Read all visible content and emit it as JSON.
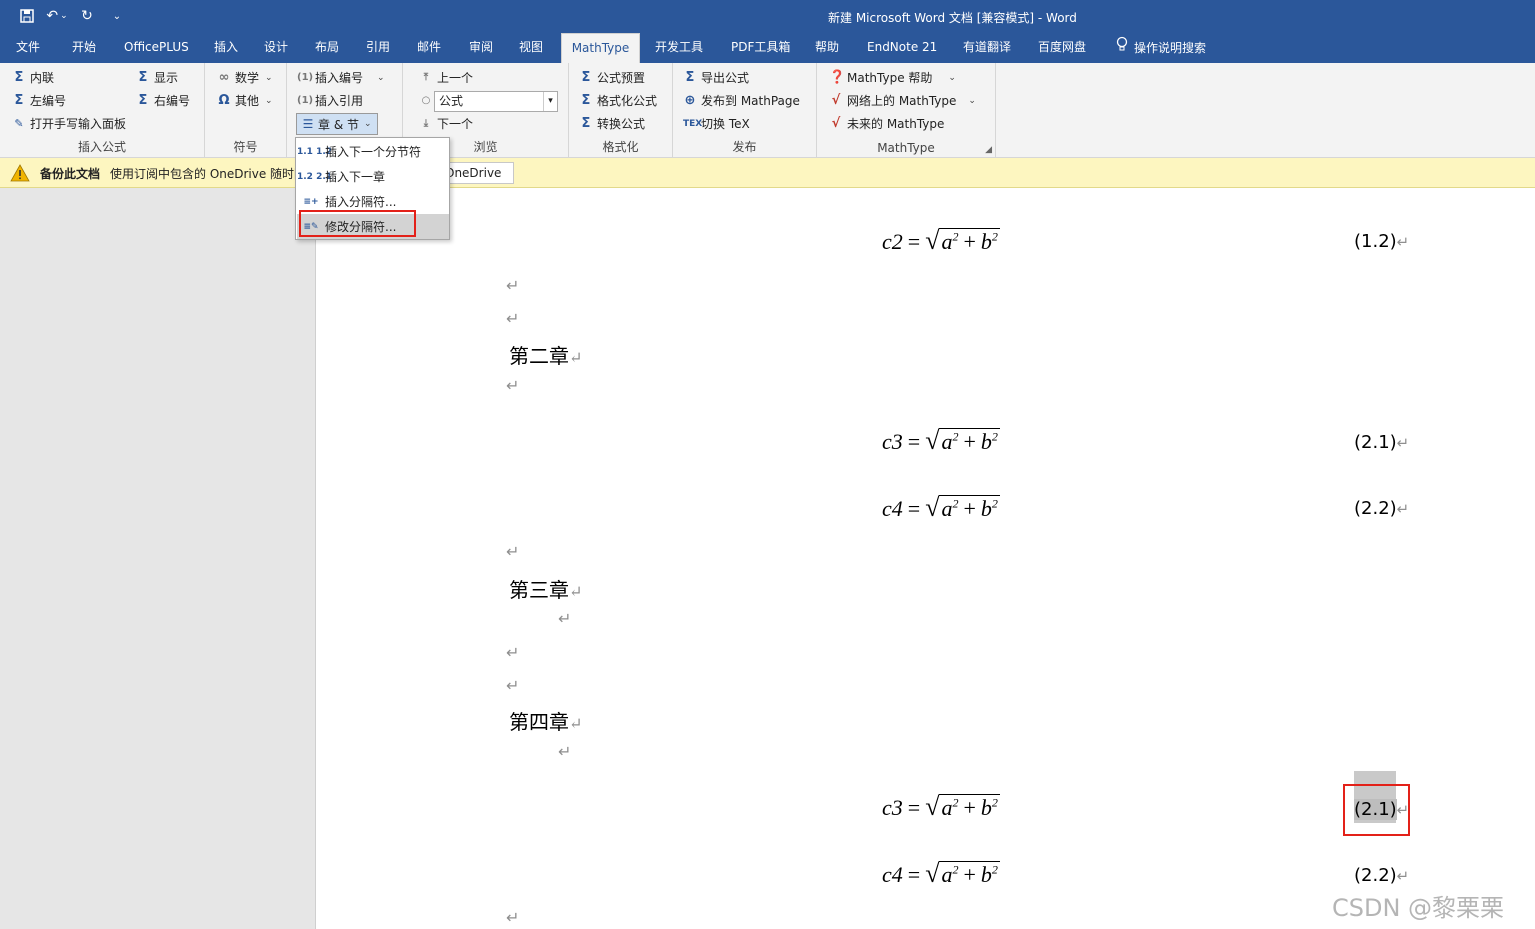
{
  "window": {
    "title": "新建 Microsoft Word 文档 [兼容模式]  -  Word"
  },
  "tabs": [
    {
      "label": "文件"
    },
    {
      "label": "开始"
    },
    {
      "label": "OfficePLUS"
    },
    {
      "label": "插入"
    },
    {
      "label": "设计"
    },
    {
      "label": "布局"
    },
    {
      "label": "引用"
    },
    {
      "label": "邮件"
    },
    {
      "label": "审阅"
    },
    {
      "label": "视图"
    },
    {
      "label": "MathType"
    },
    {
      "label": "开发工具"
    },
    {
      "label": "PDF工具箱"
    },
    {
      "label": "帮助"
    },
    {
      "label": "EndNote 21"
    },
    {
      "label": "有道翻译"
    },
    {
      "label": "百度网盘"
    },
    {
      "label": "操作说明搜索"
    }
  ],
  "ribbon": {
    "insert_equation": {
      "label": "插入公式",
      "inline": "内联",
      "display": "显示",
      "left_number": "左编号",
      "right_number": "右编号",
      "handwriting": "打开手写输入面板"
    },
    "symbols": {
      "label": "符号",
      "math": "数学",
      "other": "其他"
    },
    "numbering": {
      "insert_number": "插入编号",
      "insert_reference": "插入引用",
      "chapter_section": "章 & 节"
    },
    "browse": {
      "label": "浏览",
      "previous": "上一个",
      "combo_value": "公式",
      "next": "下一个"
    },
    "format": {
      "label": "格式化",
      "presets": "公式预置",
      "format_equations": "格式化公式",
      "convert": "转换公式"
    },
    "publish": {
      "label": "发布",
      "export": "导出公式",
      "publish_mathpage": "发布到 MathPage",
      "toggle_tex": "切换 TeX"
    },
    "mathtype": {
      "label": "MathType",
      "help": "MathType 帮助",
      "online": "网络上的 MathType",
      "future": "未来的 MathType"
    }
  },
  "message_bar": {
    "title": "备份此文档",
    "text": "使用订阅中包含的 OneDrive 随时随",
    "button": "OneDrive"
  },
  "chapter_menu": [
    {
      "icon": "1.1 1.2",
      "label": "插入下一个分节符"
    },
    {
      "icon": "1.2 2.1",
      "label": "插入下一章"
    },
    {
      "icon": "≡+",
      "label": "插入分隔符..."
    },
    {
      "icon": "≡✎",
      "label": "修改分隔符..."
    }
  ],
  "document": {
    "para_mark": "↵",
    "headings": {
      "ch2": "第二章",
      "ch3": "第三章",
      "ch4": "第四章"
    },
    "equations": {
      "c2": {
        "lhs": "c2",
        "num": "(1.2)"
      },
      "c3a": {
        "lhs": "c3",
        "num": "(2.1)"
      },
      "c4a": {
        "lhs": "c4",
        "num": "(2.2)"
      },
      "c3b": {
        "lhs": "c3",
        "num": "(2.1)"
      },
      "c4b": {
        "lhs": "c4",
        "num": "(2.2)"
      }
    },
    "eq_rhs": {
      "eq": "=",
      "a": "a",
      "plus": "+",
      "b": "b",
      "exp": "2"
    }
  },
  "watermark": "CSDN @黎栗栗"
}
